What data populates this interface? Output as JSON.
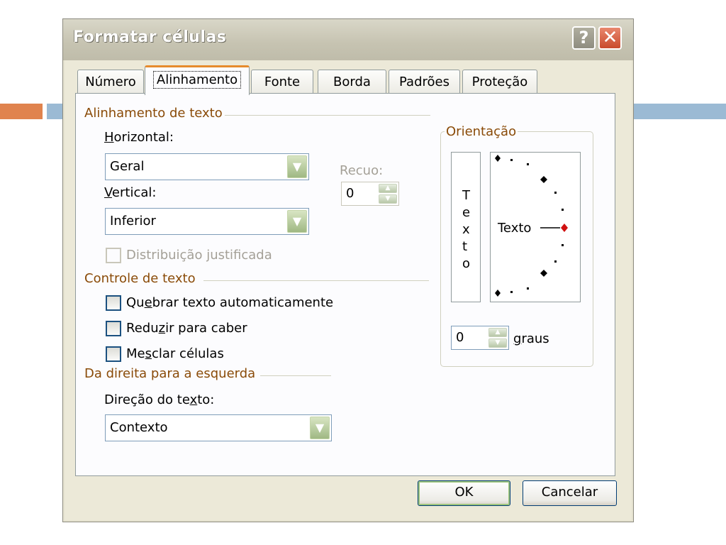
{
  "dialog": {
    "title": "Formatar células",
    "help_label": "?",
    "close_label": "✕"
  },
  "tabs": [
    {
      "label": "Número"
    },
    {
      "label": "Alinhamento",
      "active": true
    },
    {
      "label": "Fonte"
    },
    {
      "label": "Borda"
    },
    {
      "label": "Padrões"
    },
    {
      "label": "Proteção"
    }
  ],
  "text_alignment": {
    "group_title": "Alinhamento de texto",
    "horizontal": {
      "label_pre": "",
      "label_key": "H",
      "label_post": "orizontal:",
      "value": "Geral"
    },
    "vertical": {
      "label_pre": "",
      "label_key": "V",
      "label_post": "ertical:",
      "value": "Inferior"
    },
    "indent": {
      "label": "Recuo:",
      "value": "0"
    },
    "justify_distributed": {
      "label": "Distribuição justificada",
      "checked": false,
      "enabled": false
    }
  },
  "text_control": {
    "group_title": "Controle de texto",
    "wrap": {
      "label_pre": "Qu",
      "label_key": "e",
      "label_post": "brar texto automaticamente",
      "checked": false
    },
    "shrink": {
      "label_pre": "Redu",
      "label_key": "z",
      "label_post": "ir para caber",
      "checked": false
    },
    "merge": {
      "label_pre": "Me",
      "label_key": "s",
      "label_post": "clar células",
      "checked": false
    }
  },
  "rtl": {
    "group_title": "Da direita para a esquerda",
    "direction": {
      "label_pre": "Direção do te",
      "label_key": "x",
      "label_post": "to:",
      "value": "Contexto"
    }
  },
  "orientation": {
    "group_title": "Orientação",
    "vertical_text_letters": [
      "T",
      "e",
      "x",
      "t",
      "o"
    ],
    "dial_text": "Texto",
    "degrees_value": "0",
    "degrees_label_key": "g",
    "degrees_label_post": "raus",
    "pointer_color": "#d01010"
  },
  "buttons": {
    "ok": "OK",
    "cancel": "Cancelar"
  },
  "colors": {
    "accent_orange": "#e0834e",
    "accent_blue": "#9bbad4",
    "group_title": "#8a4b08",
    "active_tab": "#e68b2c"
  }
}
